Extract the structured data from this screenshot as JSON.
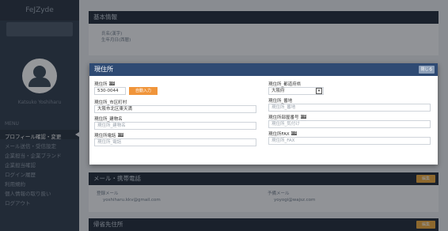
{
  "sidebar": {
    "logo": "FeJZyde",
    "user_name": "Katsuko Yoshiharu",
    "section": "MENU",
    "items": [
      "プロフィール確認・変更",
      "メール送信・受信設定",
      "企業担当・企業ブランド",
      "企業担当確認",
      "ログイン履歴",
      "利用規約",
      "個人情報の取り扱い",
      "ログアウト"
    ]
  },
  "background": {
    "basic_title": "基本情報",
    "basic_line1": "氏名(漢字)",
    "basic_line2": "生年月日(西暦)",
    "mail_title": "メール・携帯電話",
    "mail_label1": "登録メール",
    "mail_value1": "yoshiharu.kkv@gmail.com",
    "mail_label2": "予備メール",
    "mail_value2": "yoyogi@wajsz.com",
    "phone_title": "帰省先住所",
    "edit_label": "編集"
  },
  "modal": {
    "title": "現住所",
    "close_label": "閉じる",
    "required_badge": "必須",
    "left": {
      "zip_label": "現住所",
      "zip_value": "530-0044",
      "auto_button": "自動入力",
      "city_label": "現住所_市区町村",
      "city_value": "大阪市北区東天満",
      "building_label": "現住所_建物名",
      "building_placeholder": "現住所_建物名",
      "phone_label": "現住所電話",
      "phone_placeholder": "現住所_電話"
    },
    "right": {
      "pref_label": "現住所_都道府県",
      "pref_value": "大阪府",
      "pref_arrow": "▾",
      "street_label": "現住所_番地",
      "street_placeholder": "現住所_番地",
      "kana_label": "現住所部屋番号",
      "kana_placeholder": "現住所_気付け",
      "fax_label": "現住所FAX",
      "fax_placeholder": "現住所_FAX"
    }
  }
}
